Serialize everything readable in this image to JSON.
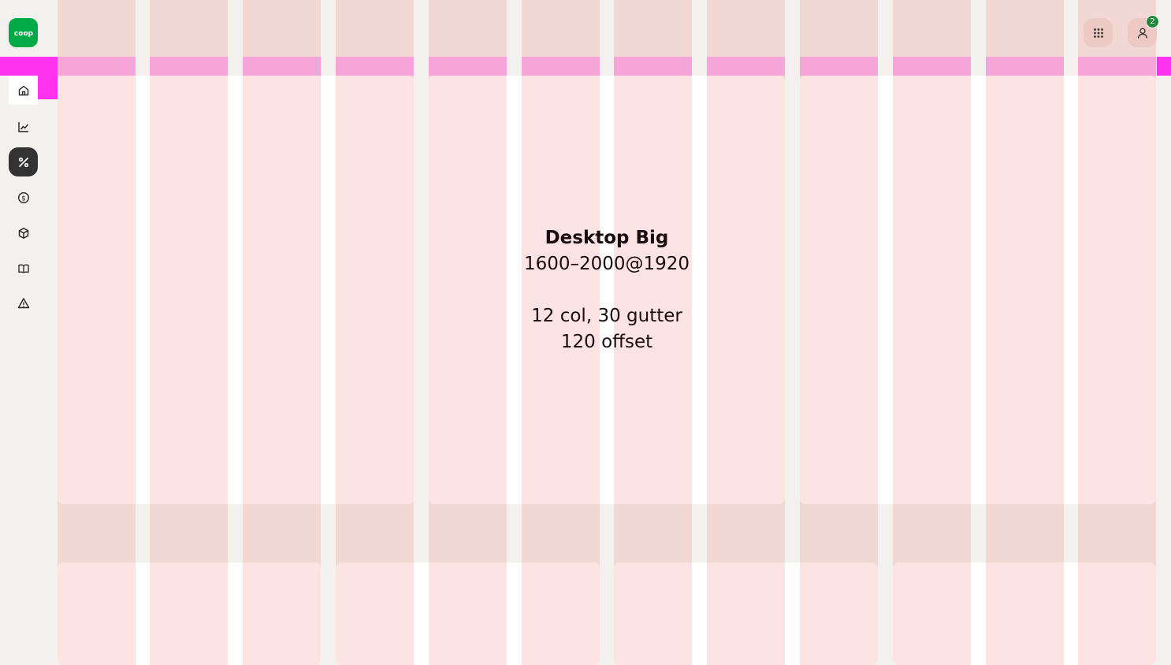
{
  "logo": {
    "text": "coop",
    "brand_color": "#00aa46"
  },
  "sidebar": {
    "items": [
      {
        "name": "home",
        "icon": "home-icon",
        "state": "default"
      },
      {
        "name": "statistics",
        "icon": "line-chart-icon",
        "state": "default"
      },
      {
        "name": "promotions",
        "icon": "percent-icon",
        "state": "active"
      },
      {
        "name": "finance",
        "icon": "dollar-circle-icon",
        "state": "default"
      },
      {
        "name": "products",
        "icon": "package-icon",
        "state": "default"
      },
      {
        "name": "catalog",
        "icon": "book-icon",
        "state": "default"
      },
      {
        "name": "alerts",
        "icon": "warning-icon",
        "state": "default"
      }
    ]
  },
  "header": {
    "apps_icon": "grid-apps-icon",
    "profile_icon": "user-icon",
    "notification_count": "2"
  },
  "grid_info": {
    "title": "Desktop Big",
    "range": "1600–2000@1920",
    "columns_line": "12 col, 30 gutter",
    "offset_line": "120 offset"
  },
  "colors": {
    "background": "#f2f1ee",
    "column": "#f2d8d5",
    "column_strip": "#f6a5d8",
    "margin_marker": "#ff33ee",
    "card_column": "#fde3e4",
    "active_nav": "#333333",
    "badge": "#1f8a3a"
  }
}
